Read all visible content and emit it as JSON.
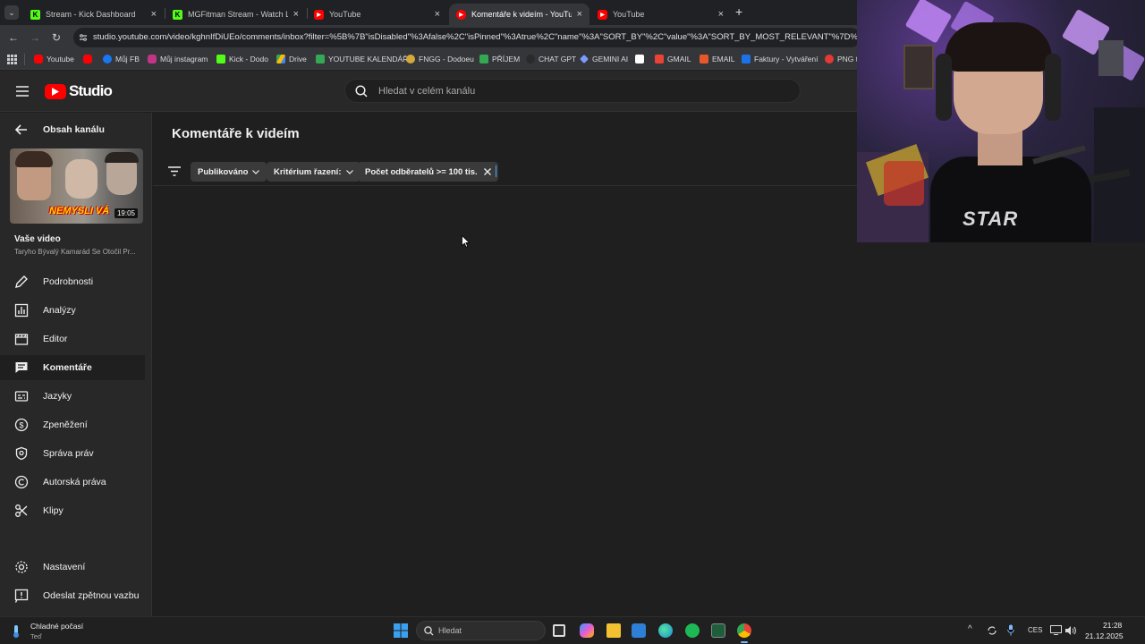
{
  "browser": {
    "tabs": [
      {
        "title": "Stream - Kick Dashboard",
        "icon": "kick-icon",
        "color": "#53fc18",
        "letter": "K"
      },
      {
        "title": "MGFitman Stream - Watch Live",
        "icon": "kick-icon",
        "color": "#53fc18",
        "letter": "K"
      },
      {
        "title": "YouTube",
        "icon": "youtube-icon",
        "color": "#ff0000",
        "letter": "▶"
      },
      {
        "title": "Komentáře k videím - YouTube",
        "icon": "youtube-studio-icon",
        "color": "#ff0000",
        "letter": "▶",
        "active": true
      },
      {
        "title": "YouTube",
        "icon": "youtube-icon",
        "color": "#ff0000",
        "letter": "▶"
      }
    ],
    "url": "studio.youtube.com/video/kghnIfDiUEo/comments/inbox?filter=%5B%7B\"isDisabled\"%3Afalse%2C\"isPinned\"%3Atrue%2C\"name\"%3A\"SORT_BY\"%2C\"value\"%3A\"SORT_BY_MOST_RELEVANT\"%7D%2C%7B\"nam",
    "bookmarks": [
      {
        "label": "Youtube",
        "color": "#ff0000"
      },
      {
        "label": "Můj FB",
        "color": "#ff0000"
      },
      {
        "label": "Můj instagram",
        "color": "#1877f2"
      },
      {
        "label": "Kick - Dodo",
        "color": "#53fc18"
      },
      {
        "label": "Drive",
        "color": "#fbbc04"
      },
      {
        "label": "YOUTUBE KALENDÁŘ",
        "color": "#34a853"
      },
      {
        "label": "FNGG - Dodoeu",
        "color": "#d4a93a"
      },
      {
        "label": "PŘÍJEM",
        "color": "#34a853"
      },
      {
        "label": "CHAT GPT",
        "color": "#444444"
      },
      {
        "label": "GEMINI AI",
        "color": "#7b9cff"
      },
      {
        "label": "",
        "color": "#ffffff"
      },
      {
        "label": "GMAIL",
        "color": "#ea4335"
      },
      {
        "label": "EMAIL",
        "color": "#e8572a"
      },
      {
        "label": "Faktury - Vytváření",
        "color": "#1a73e8"
      },
      {
        "label": "PNG t",
        "color": "#e53935"
      }
    ]
  },
  "studio": {
    "logo_text": "Studio",
    "search_placeholder": "Hledat v celém kanálu",
    "back_label": "Obsah kanálu",
    "video": {
      "duration": "19:05",
      "thumb_text": "NEMYSLI VÁ",
      "section_label": "Vaše video",
      "title": "Taryho Bývalý Kamarád Se Otočil Pr..."
    },
    "nav": [
      {
        "label": "Podrobnosti",
        "icon": "pencil-icon"
      },
      {
        "label": "Analýzy",
        "icon": "analytics-icon"
      },
      {
        "label": "Editor",
        "icon": "editor-icon"
      },
      {
        "label": "Komentáře",
        "icon": "comments-icon",
        "active": true
      },
      {
        "label": "Jazyky",
        "icon": "subtitles-icon"
      },
      {
        "label": "Zpeněžení",
        "icon": "dollar-icon"
      },
      {
        "label": "Správa práv",
        "icon": "rights-icon"
      },
      {
        "label": "Autorská práva",
        "icon": "copyright-icon"
      },
      {
        "label": "Klipy",
        "icon": "scissors-icon"
      }
    ],
    "bottom_nav": [
      {
        "label": "Nastavení",
        "icon": "gear-icon"
      },
      {
        "label": "Odeslat zpětnou vazbu",
        "icon": "feedback-icon"
      }
    ],
    "page_title": "Komentáře k videím",
    "filters": [
      {
        "label": "Publikováno",
        "type": "dropdown"
      },
      {
        "label": "Kritérium řazení:",
        "type": "dropdown"
      },
      {
        "label": "Počet odběratelů >= 100 tis.",
        "type": "removable"
      }
    ]
  },
  "webcam": {
    "shirt_text": "STAR"
  },
  "taskbar": {
    "weather_title": "Chladné počasí",
    "weather_sub": "Teď",
    "search_placeholder": "Hledat",
    "lang": "CES",
    "time": "21:28",
    "date": "21.12.2025"
  },
  "colors": {
    "studio_bg": "#1f1f1f",
    "panel_bg": "#282828",
    "youtube_red": "#ff0000",
    "chip_bg": "#3a3a3a"
  }
}
